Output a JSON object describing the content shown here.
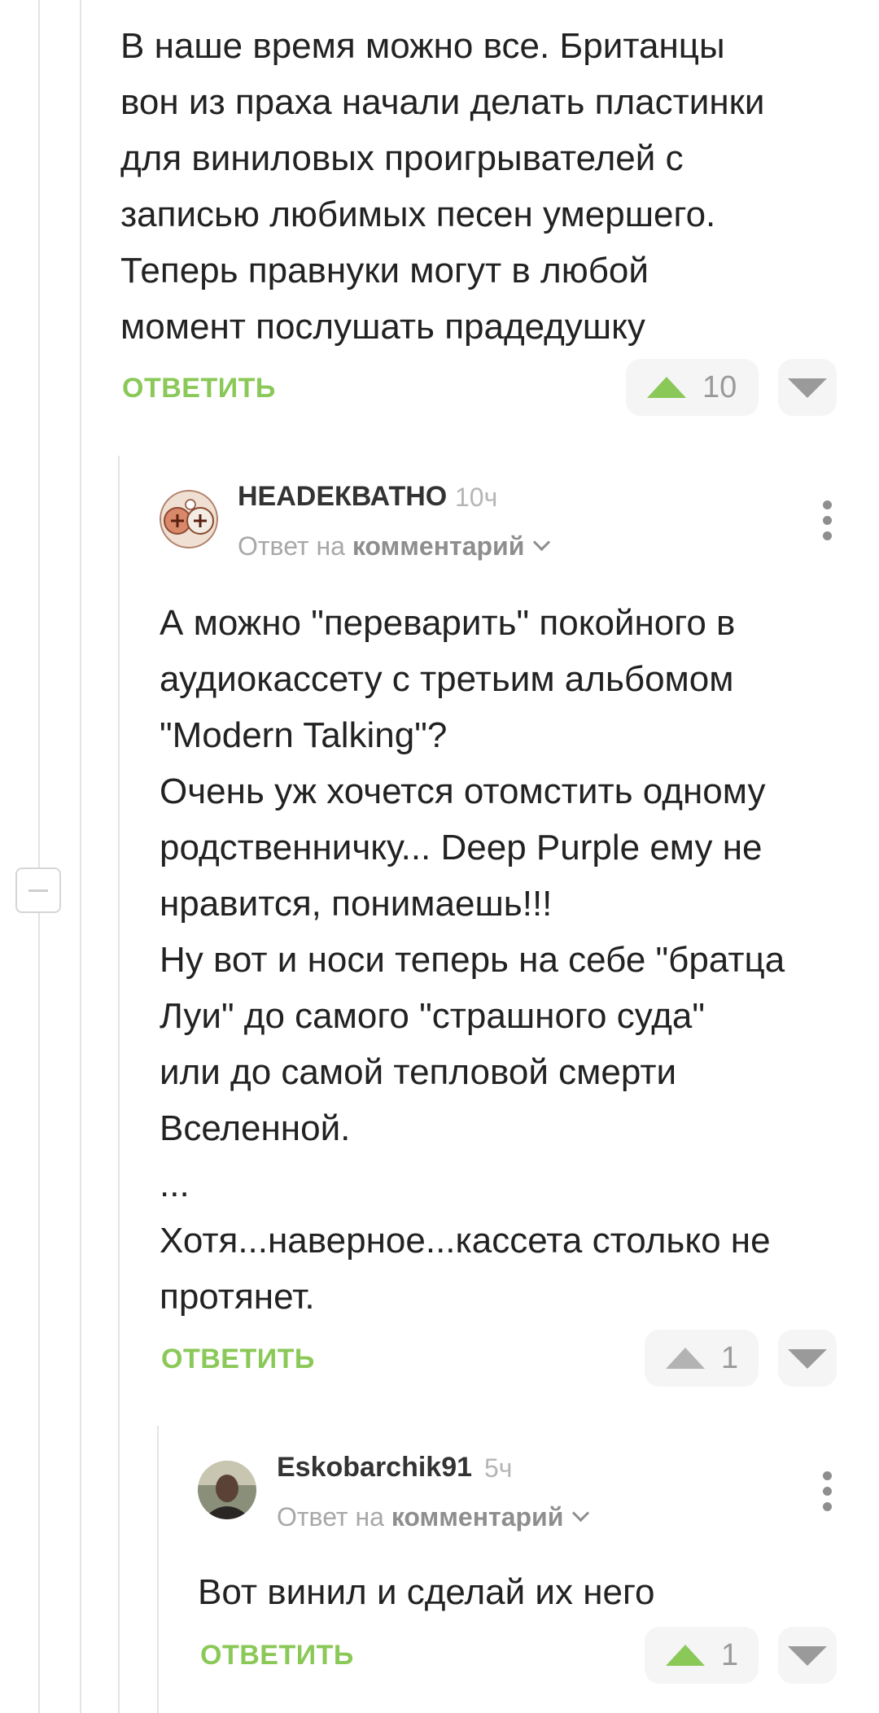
{
  "comments": [
    {
      "text": "В наше время можно все. Британцы\nвон из праха начали делать пластинки\nдля виниловых проигрывателей с\nзаписью любимых песен умершего.\nТеперь правнуки могут в любой\nмомент послушать прадедушку",
      "reply_label": "ОТВЕТИТЬ",
      "rating": "10"
    },
    {
      "username": "НЕАDЕКВАТНО",
      "time": "10ч",
      "reply_to_prefix": "Ответ на",
      "reply_to_link": "комментарий",
      "text": "А можно \"переварить\" покойного в\nаудиокассету с третьим альбомом\n\"Modern Talking\"?\nОчень уж хочется отомстить одному\nродственничку... Deep Purple ему не\nнравится, понимаешь!!!\nНу вот и носи теперь на себе \"братца\nЛуи\" до самого \"страшного суда\"\nили до самой тепловой смерти\nВселенной.\n...\nХотя...наверное...кассета столько не\nпротянет.",
      "reply_label": "ОТВЕТИТЬ",
      "rating": "1"
    },
    {
      "username": "Eskobarchik91",
      "time": "5ч",
      "reply_to_prefix": "Ответ на",
      "reply_to_link": "комментарий",
      "text": "Вот винил и сделай их него",
      "reply_label": "ОТВЕТИТЬ",
      "rating": "1"
    }
  ],
  "colors": {
    "accent": "#8ac858",
    "muted": "#9a9a9a",
    "thread_line": "#e3e3e3"
  },
  "icons": [
    "upvote-icon",
    "downvote-icon",
    "more-options-icon",
    "chevron-down-icon",
    "collapse-thread-icon"
  ]
}
